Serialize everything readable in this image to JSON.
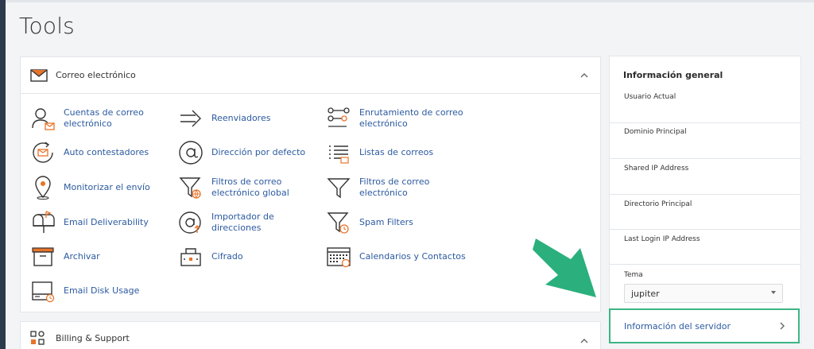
{
  "page": {
    "title": "Tools"
  },
  "email_section": {
    "title": "Correo electrónico",
    "tools": [
      {
        "label": "Cuentas de correo electrónico",
        "icon": "user-mail-icon"
      },
      {
        "label": "Reenviadores",
        "icon": "forward-arrow-icon"
      },
      {
        "label": "Enrutamiento de correo electrónico",
        "icon": "routing-icon"
      },
      {
        "label": "Auto contestadores",
        "icon": "autoresponder-icon"
      },
      {
        "label": "Dirección por defecto",
        "icon": "at-sign-icon"
      },
      {
        "label": "Listas de correos",
        "icon": "list-icon"
      },
      {
        "label": "Monitorizar el envío",
        "icon": "map-pin-icon"
      },
      {
        "label": "Filtros de correo electrónico global",
        "icon": "funnel-globe-icon"
      },
      {
        "label": "Filtros de correo electrónico",
        "icon": "funnel-icon"
      },
      {
        "label": "Email Deliverability",
        "icon": "mailbox-icon"
      },
      {
        "label": "Importador de direcciones",
        "icon": "at-import-icon"
      },
      {
        "label": "Spam Filters",
        "icon": "funnel-clock-icon"
      },
      {
        "label": "Archivar",
        "icon": "archive-box-icon"
      },
      {
        "label": "Cifrado",
        "icon": "lock-box-icon"
      },
      {
        "label": "Calendarios y Contactos",
        "icon": "calendar-icon"
      },
      {
        "label": "Email Disk Usage",
        "icon": "disk-usage-icon"
      }
    ]
  },
  "billing_section": {
    "title": "Billing & Support"
  },
  "sidebar": {
    "title": "Información general",
    "rows": [
      {
        "label": "Usuario Actual"
      },
      {
        "label": "Dominio Principal"
      },
      {
        "label": "Shared IP Address"
      },
      {
        "label": "Directorio Principal"
      },
      {
        "label": "Last Login IP Address"
      }
    ],
    "theme_label": "Tema",
    "theme_value": "jupiter",
    "server_info": "Información del servidor"
  },
  "colors": {
    "accent_link": "#2c5aa0",
    "highlight": "#3cb585",
    "icon_orange": "#e8742a"
  }
}
